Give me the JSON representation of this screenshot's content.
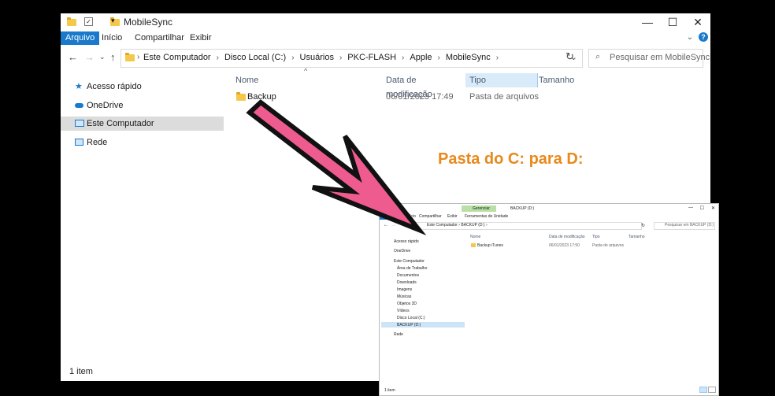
{
  "main_window": {
    "title": "MobileSync",
    "ribbon_tabs": [
      "Arquivo",
      "Início",
      "Compartilhar",
      "Exibir"
    ],
    "breadcrumbs": [
      "Este Computador",
      "Disco Local (C:)",
      "Usuários",
      "PKC-FLASH",
      "Apple",
      "MobileSync"
    ],
    "search_placeholder": "Pesquisar em MobileSync",
    "nav_items": [
      "Acesso rápido",
      "OneDrive",
      "Este Computador",
      "Rede"
    ],
    "selected_nav": "Este Computador",
    "columns": [
      "Nome",
      "Data de modificação",
      "Tipo",
      "Tamanho"
    ],
    "files": [
      {
        "name": "Backup",
        "modified": "06/01/2023 17:49",
        "type": "Pasta de arquivos",
        "size": ""
      }
    ],
    "status": "1 item"
  },
  "annotation": "Pasta do C: para D:",
  "second_window": {
    "title": "BACKUP (D:)",
    "context_tab": "Gerenciar",
    "ribbon_tabs": [
      "Arquivo",
      "Início",
      "Compartilhar",
      "Exibir",
      "Ferramentas de Unidade"
    ],
    "breadcrumbs": [
      "Este Computador",
      "BACKUP (D:)"
    ],
    "search_placeholder": "Pesquisar em BACKUP (D:)",
    "nav_items": [
      "Acesso rápido",
      "OneDrive",
      "Este Computador",
      "Área de Trabalho",
      "Documentos",
      "Downloads",
      "Imagens",
      "Músicas",
      "Objetos 3D",
      "Vídeos",
      "Disco Local (C:)",
      "BACKUP (D:)",
      "Rede"
    ],
    "selected_nav": "BACKUP (D:)",
    "columns": [
      "Nome",
      "Data de modificação",
      "Tipo",
      "Tamanho"
    ],
    "files": [
      {
        "name": "Backup iTunes",
        "modified": "06/01/2023 17:50",
        "type": "Pasta de arquivos"
      }
    ],
    "status": "1 item"
  },
  "colors": {
    "accent": "#1979ca",
    "annotation": "#e8891c",
    "arrow_fill": "#ee5b8f"
  }
}
